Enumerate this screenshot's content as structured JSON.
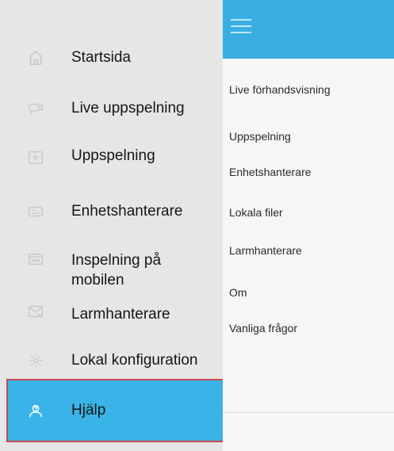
{
  "sidebar": {
    "items": [
      {
        "label": "Startsida",
        "icon": "home-icon"
      },
      {
        "label": "Live uppspelning",
        "icon": "camera-icon"
      },
      {
        "label": "Uppspelning",
        "icon": "playback-icon"
      },
      {
        "label": "Enhetshanterare",
        "icon": "device-icon"
      },
      {
        "label": "Inspelning på mobilen",
        "icon": "recording-icon"
      },
      {
        "label": "Larmhanterare",
        "icon": "alarm-icon"
      },
      {
        "label": "Lokal konfiguration",
        "icon": "settings-icon"
      },
      {
        "label": "Hjälp",
        "icon": "help-icon"
      }
    ]
  },
  "menu": {
    "items": [
      "Live förhandsvisning",
      "Uppspelning",
      "Enhetshanterare",
      "Lokala filer",
      "Larmhanterare",
      "Om",
      "Vanliga frågor"
    ]
  },
  "colors": {
    "accent": "#3aaee3",
    "highlight": "#3ab4e8",
    "highlight_border": "#c9484e",
    "sidebar_bg": "#e6e6e6"
  }
}
